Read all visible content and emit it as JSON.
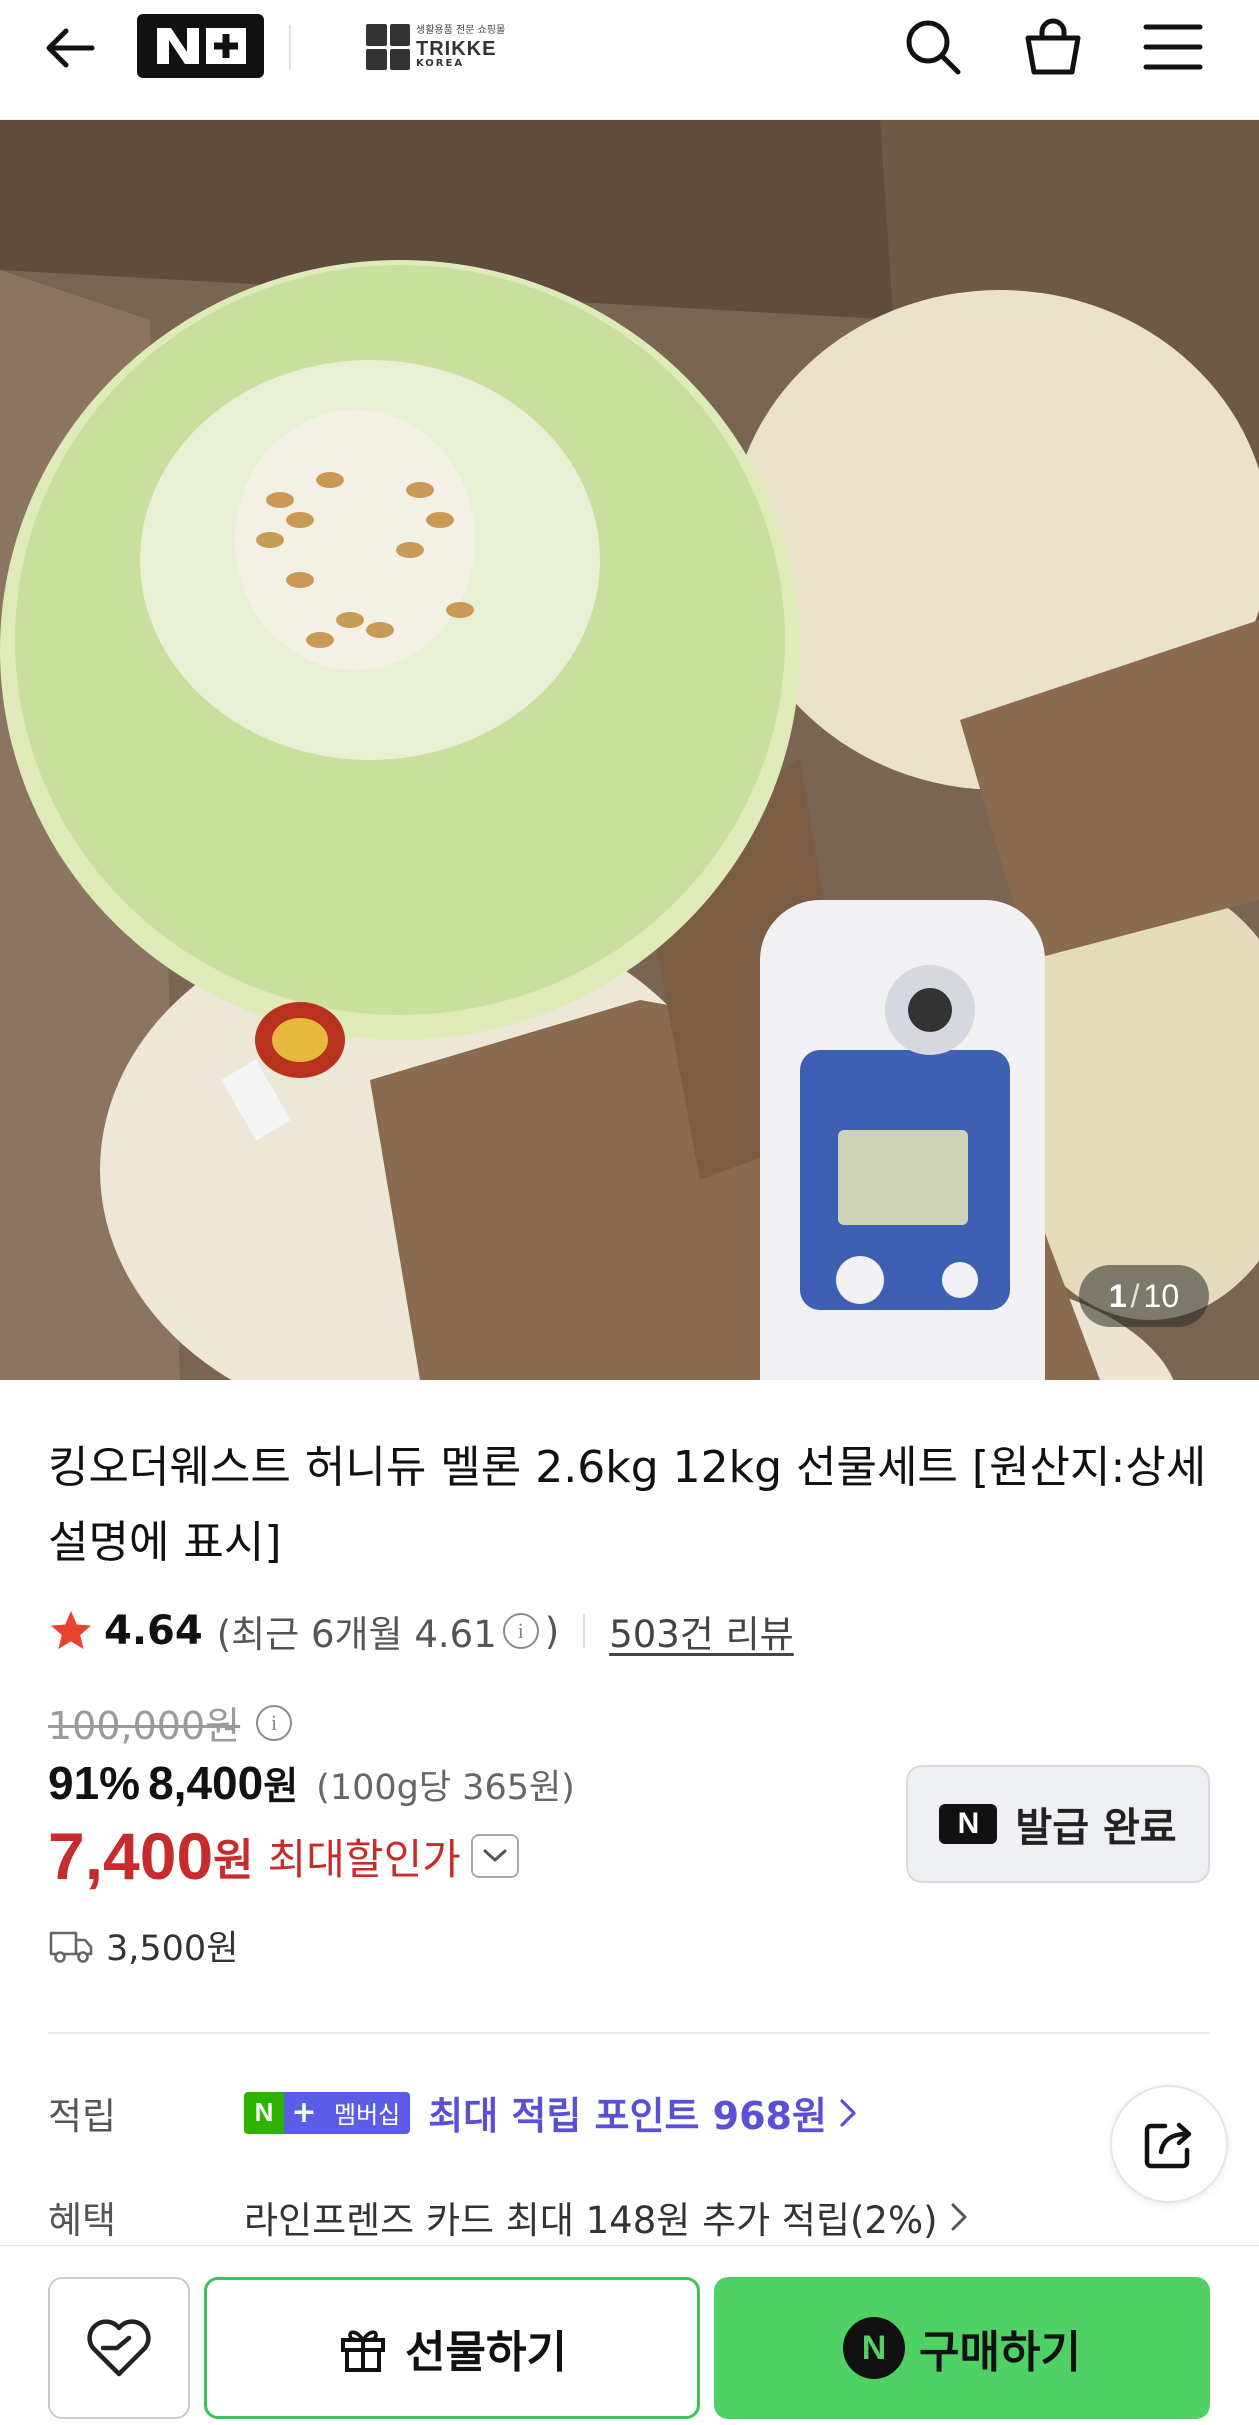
{
  "header": {
    "logo_text": "N+",
    "store_logo": {
      "sub": "생활용품 전문 쇼핑몰",
      "main": "TRIKKE",
      "small": "KOREA"
    }
  },
  "gallery": {
    "current": "1",
    "separator": "/",
    "total": "10"
  },
  "product": {
    "title": "킹오더웨스트 허니듀 멜론 2.6kg 12kg 선물세트 [원산지:상세설명에 표시]",
    "rating": "4.64",
    "recent_rating": "(최근 6개월 4.61",
    "recent_rating_close": ")",
    "reviews": "503건 리뷰"
  },
  "price": {
    "original": "100,000원",
    "discount_rate": "91%",
    "sale_price": "8,400",
    "sale_currency": "원",
    "unit_price": "(100g당 365원)",
    "best_price": "7,400",
    "best_currency": "원",
    "best_label": "최대할인가",
    "coupon_button": "발급 완료",
    "coupon_n": "N"
  },
  "shipping": {
    "fee": "3,500원"
  },
  "points": {
    "label": "적립",
    "badge_n": "N",
    "badge_plus": "+",
    "badge_text": "멤버십",
    "text": "최대 적립 포인트 968원"
  },
  "benefit": {
    "label": "혜택",
    "text": "라인프렌즈 카드 최대 148원 추가 적립(2%)"
  },
  "bottom_bar": {
    "gift_label": "선물하기",
    "buy_n": "N",
    "buy_label": "구매하기"
  },
  "colors": {
    "accent_green": "#4fd165",
    "price_red": "#c62c2c",
    "points_purple": "#5b4fd6",
    "star_red": "#e8432e"
  }
}
